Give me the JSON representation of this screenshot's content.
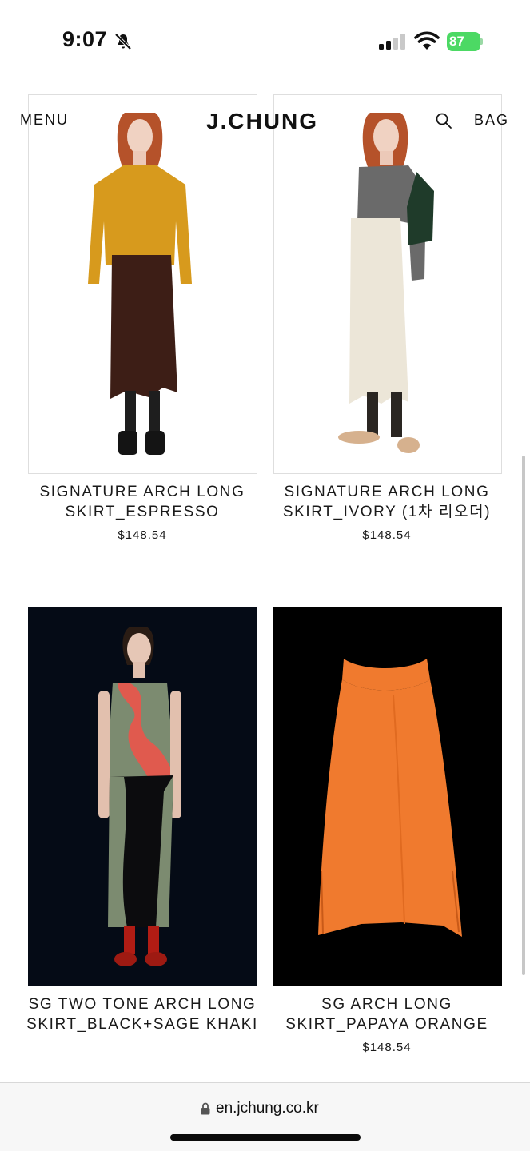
{
  "status_bar": {
    "time": "9:07",
    "battery": "87",
    "icons": [
      "mute-icon",
      "signal-icon",
      "wifi-icon",
      "battery-icon"
    ]
  },
  "header": {
    "menu_label": "MENU",
    "brand": "J.CHUNG",
    "bag_label": "BAG",
    "icons": [
      "search-icon"
    ]
  },
  "products": [
    {
      "name": "SIGNATURE ARCH LONG SKIRT_ESPRESSO",
      "price": "$148.54"
    },
    {
      "name": "SIGNATURE ARCH LONG SKIRT_IVORY (1차 리오더)",
      "price": "$148.54"
    },
    {
      "name": "SG TWO TONE ARCH LONG SKIRT_BLACK+SAGE KHAKI",
      "price": ""
    },
    {
      "name": "SG ARCH LONG SKIRT_PAPAYA ORANGE",
      "price": "$148.54"
    }
  ],
  "browser": {
    "url": "en.jchung.co.kr",
    "icons": [
      "lock-icon"
    ]
  }
}
